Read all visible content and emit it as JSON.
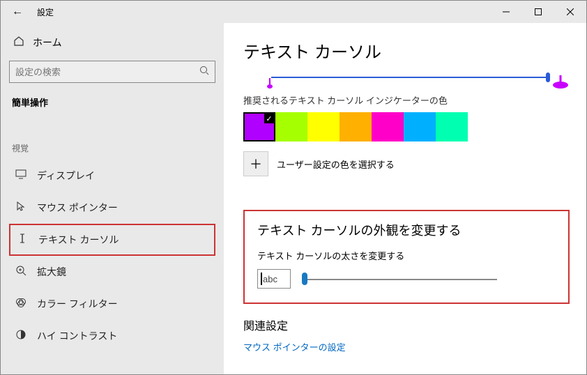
{
  "window": {
    "title": "設定"
  },
  "sidebar": {
    "home": "ホーム",
    "search_placeholder": "設定の検索",
    "section_label": "簡単操作",
    "group_label": "視覚",
    "items": [
      {
        "icon": "display",
        "label": "ディスプレイ"
      },
      {
        "icon": "pointer",
        "label": "マウス ポインター"
      },
      {
        "icon": "textcursor",
        "label": "テキスト カーソル",
        "selected": true
      },
      {
        "icon": "magnifier",
        "label": "拡大鏡"
      },
      {
        "icon": "colorfilter",
        "label": "カラー フィルター"
      },
      {
        "icon": "highcontrast",
        "label": "ハイ コントラスト"
      }
    ]
  },
  "main": {
    "title": "テキスト カーソル",
    "indicator_label": "推奨されるテキスト カーソル インジケーターの色",
    "swatches": [
      {
        "color": "#b000ff",
        "selected": true
      },
      {
        "color": "#a6ff00"
      },
      {
        "color": "#ffff00"
      },
      {
        "color": "#ffb000"
      },
      {
        "color": "#ff00c8"
      },
      {
        "color": "#00b0ff"
      },
      {
        "color": "#00ffb0"
      }
    ],
    "custom_color_label": "ユーザー設定の色を選択する",
    "appearance_heading": "テキスト カーソルの外観を変更する",
    "thickness_label": "テキスト カーソルの太さを変更する",
    "preview_text": "abc",
    "related_heading": "関連設定",
    "related_link": "マウス ポインターの設定"
  }
}
